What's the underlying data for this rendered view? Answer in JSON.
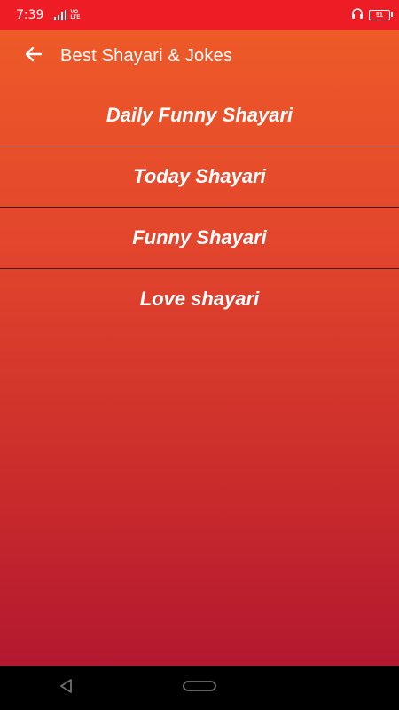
{
  "status_bar": {
    "time": "7:39",
    "network_top": "VO",
    "network_bottom": "LTE",
    "battery": "51"
  },
  "toolbar": {
    "title": "Best Shayari & Jokes",
    "back_icon": "arrow-left-icon"
  },
  "menu": {
    "items": [
      {
        "label": "Daily Funny Shayari"
      },
      {
        "label": "Today Shayari"
      },
      {
        "label": "Funny Shayari"
      },
      {
        "label": "Love shayari"
      }
    ]
  },
  "nav_bar": {
    "back_icon": "triangle-back-icon",
    "home_icon": "pill-home-icon",
    "recents_icon": "recents-icon"
  },
  "colors": {
    "status_bar": "#ee1d25",
    "gradient_top": "#f05d28",
    "gradient_bottom": "#ad1330",
    "divider": "#4a1b12"
  }
}
